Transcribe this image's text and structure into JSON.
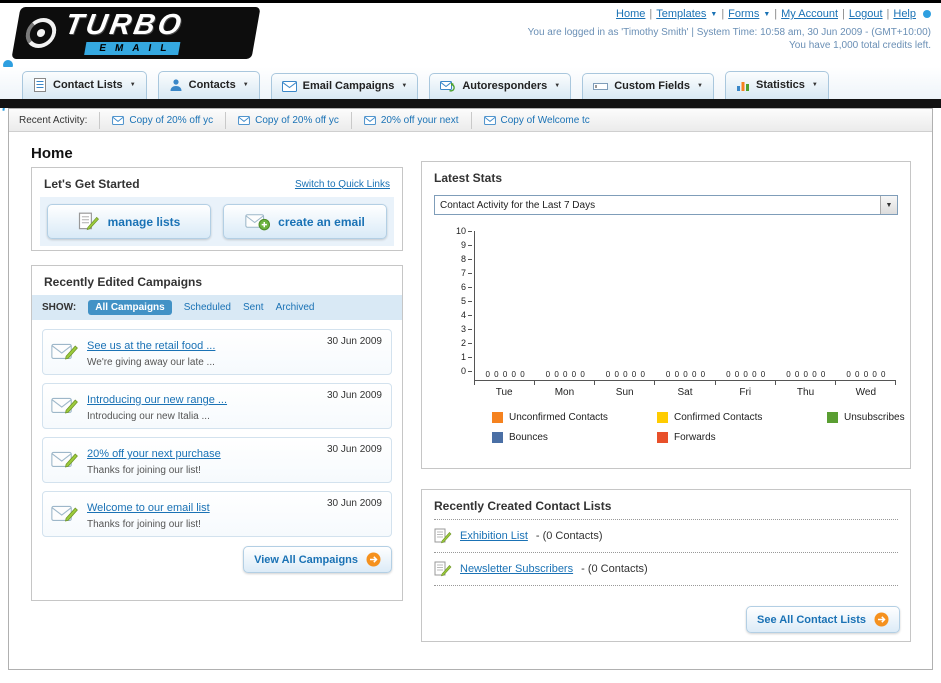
{
  "header": {
    "logo": {
      "title": "TURBO",
      "subtitle": "EMAIL"
    },
    "nav_links": [
      {
        "label": "Home",
        "dropdown": false
      },
      {
        "label": "Templates",
        "dropdown": true
      },
      {
        "label": "Forms",
        "dropdown": true
      },
      {
        "label": "My Account",
        "dropdown": false
      },
      {
        "label": "Logout",
        "dropdown": false
      },
      {
        "label": "Help",
        "dropdown": false
      }
    ],
    "login_info": "You are logged in as 'Timothy Smith' | System Time: 10:58 am, 30 Jun 2009 - (GMT+10:00)",
    "credits_info": "You have 1,000 total credits left."
  },
  "main_nav": {
    "tabs": [
      {
        "label": "Contact Lists"
      },
      {
        "label": "Contacts"
      },
      {
        "label": "Email Campaigns"
      },
      {
        "label": "Autoresponders"
      },
      {
        "label": "Custom Fields"
      },
      {
        "label": "Statistics"
      }
    ]
  },
  "recent_activity": {
    "label": "Recent Activity:",
    "items": [
      "Copy of 20% off yc",
      "Copy of 20% off yc",
      "20% off your next",
      "Copy of Welcome tc"
    ]
  },
  "page": {
    "title": "Home"
  },
  "get_started": {
    "title": "Let's Get Started",
    "switch_link": "Switch to Quick Links",
    "buttons": [
      {
        "label": "manage lists"
      },
      {
        "label": "create an email"
      }
    ]
  },
  "campaigns": {
    "title": "Recently Edited Campaigns",
    "show_label": "SHOW:",
    "filters": [
      {
        "label": "All Campaigns",
        "selected": true
      },
      {
        "label": "Scheduled",
        "selected": false
      },
      {
        "label": "Sent",
        "selected": false
      },
      {
        "label": "Archived",
        "selected": false
      }
    ],
    "items": [
      {
        "title": "See us at the retail food ...",
        "subtitle": "We're giving away our late ...",
        "date": "30 Jun 2009"
      },
      {
        "title": "Introducing our new range ...",
        "subtitle": "Introducing our new Italia ...",
        "date": "30 Jun 2009"
      },
      {
        "title": "20% off your next purchase",
        "subtitle": "Thanks for joining our list!",
        "date": "30 Jun 2009"
      },
      {
        "title": "Welcome to our email list",
        "subtitle": "Thanks for joining our list!",
        "date": "30 Jun 2009"
      }
    ],
    "view_all_label": "View All Campaigns"
  },
  "stats": {
    "title": "Latest Stats",
    "dropdown_value": "Contact Activity for the Last 7 Days",
    "legend": [
      {
        "label": "Unconfirmed Contacts",
        "color": "#f5821f"
      },
      {
        "label": "Confirmed Contacts",
        "color": "#ffcc00"
      },
      {
        "label": "Unsubscribes",
        "color": "#5a9e32"
      },
      {
        "label": "Bounces",
        "color": "#4a6fa5"
      },
      {
        "label": "Forwards",
        "color": "#e8502a"
      }
    ]
  },
  "chart_data": {
    "type": "bar",
    "title": "Contact Activity for the Last 7 Days",
    "categories": [
      "Tue",
      "Mon",
      "Sun",
      "Sat",
      "Fri",
      "Thu",
      "Wed"
    ],
    "series": [
      {
        "name": "Unconfirmed Contacts",
        "color": "#f5821f",
        "values": [
          0,
          0,
          0,
          0,
          0,
          0,
          0
        ]
      },
      {
        "name": "Confirmed Contacts",
        "color": "#ffcc00",
        "values": [
          0,
          0,
          0,
          0,
          0,
          0,
          0
        ]
      },
      {
        "name": "Unsubscribes",
        "color": "#5a9e32",
        "values": [
          0,
          0,
          0,
          0,
          0,
          0,
          0
        ]
      },
      {
        "name": "Bounces",
        "color": "#4a6fa5",
        "values": [
          0,
          0,
          0,
          0,
          0,
          0,
          0
        ]
      },
      {
        "name": "Forwards",
        "color": "#e8502a",
        "values": [
          0,
          0,
          0,
          0,
          0,
          0,
          0
        ]
      }
    ],
    "xlabel": "",
    "ylabel": "",
    "ylim": [
      0,
      10
    ],
    "yticks": [
      0,
      1,
      2,
      3,
      4,
      5,
      6,
      7,
      8,
      9,
      10
    ],
    "grid": false,
    "legend_position": "bottom",
    "data_labels": "zeros shown above baseline for every series in every category"
  },
  "contact_lists": {
    "title": "Recently Created Contact Lists",
    "items": [
      {
        "name": "Exhibition List",
        "suffix": "- (0 Contacts)"
      },
      {
        "name": "Newsletter Subscribers",
        "suffix": "- (0 Contacts)"
      }
    ],
    "see_all_label": "See All Contact Lists"
  }
}
